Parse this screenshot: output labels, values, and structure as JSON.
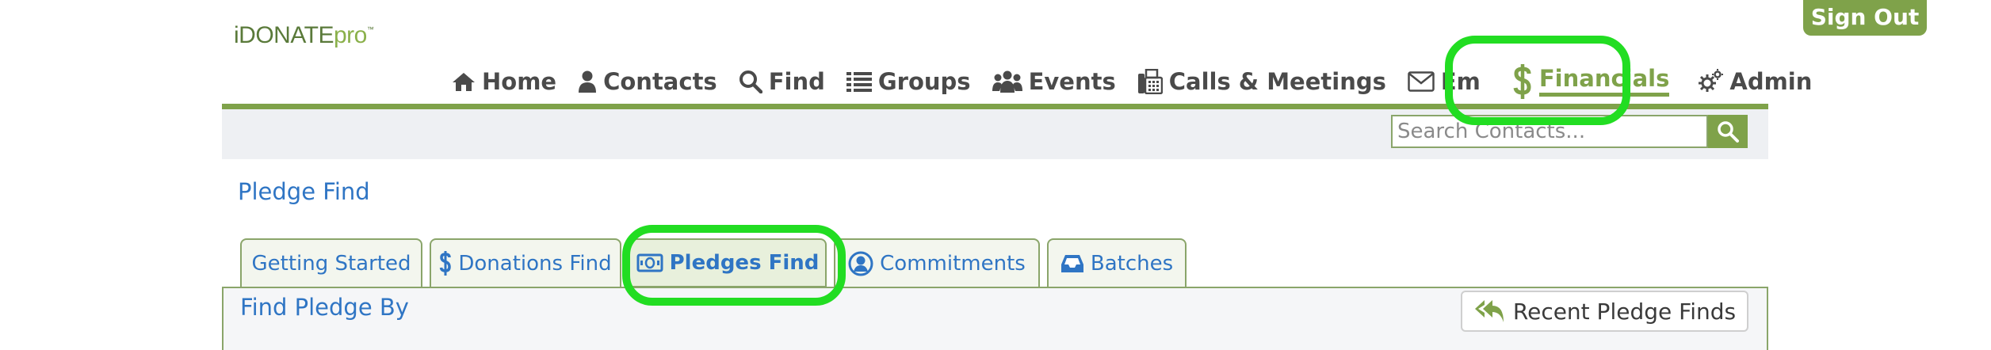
{
  "logo": {
    "brand": "iDONATE",
    "suffix": "pro",
    "tm": "™"
  },
  "header": {
    "sign_out_label": "Sign Out"
  },
  "nav": {
    "items": [
      {
        "label": "Home",
        "icon": "home-icon"
      },
      {
        "label": "Contacts",
        "icon": "person-icon"
      },
      {
        "label": "Find",
        "icon": "search-icon"
      },
      {
        "label": "Groups",
        "icon": "list-icon"
      },
      {
        "label": "Events",
        "icon": "people-group-icon"
      },
      {
        "label": "Calls & Meetings",
        "icon": "fax-phone-icon"
      },
      {
        "label": "Email",
        "icon": "envelope-icon"
      },
      {
        "label": "Financials",
        "icon": "dollar-icon",
        "active": true
      },
      {
        "label": "Admin",
        "icon": "gears-icon"
      }
    ]
  },
  "search": {
    "placeholder": "Search Contacts..."
  },
  "page": {
    "title": "Pledge Find"
  },
  "tabs": [
    {
      "label": "Getting Started"
    },
    {
      "label": "Donations Find",
      "icon": "dollar-icon"
    },
    {
      "label": "Pledges Find",
      "icon": "money-bill-icon",
      "active": true
    },
    {
      "label": "Commitments",
      "icon": "user-circle-icon"
    },
    {
      "label": "Batches",
      "icon": "inbox-icon"
    }
  ],
  "panel": {
    "title": "Find Pledge By",
    "recent_button_label": "Recent Pledge Finds"
  },
  "colors": {
    "accent_green": "#7fa24a",
    "link_blue": "#2f75c4",
    "highlight": "#22dd22"
  }
}
